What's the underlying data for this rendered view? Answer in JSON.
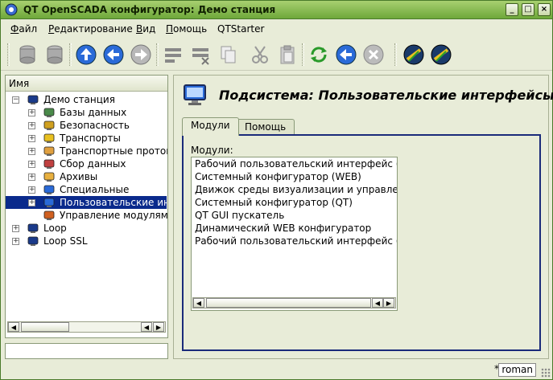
{
  "window": {
    "title": "QT OpenSCADA конфигуратор: Демо станция",
    "controls": [
      "_",
      "□",
      "×"
    ]
  },
  "menu": [
    {
      "label": "Файл",
      "underline": "Ф",
      "rest": "айл"
    },
    {
      "label": "Редактирование",
      "underline": "Р",
      "rest": "едактирование"
    },
    {
      "label": "Вид",
      "underline": "В",
      "rest": "ид"
    },
    {
      "label": "Помощь",
      "underline": "П",
      "rest": "омощь"
    },
    {
      "label": "QTStarter",
      "underline": "",
      "rest": "QTStarter"
    }
  ],
  "toolbar": {
    "icons": [
      "db-load-icon",
      "db-save-icon",
      "up-icon",
      "back-icon",
      "forward-icon",
      "add-item-icon",
      "delete-item-icon",
      "copy-icon",
      "cut-icon",
      "paste-icon",
      "refresh-icon",
      "start-icon",
      "stop-icon",
      "webcfg-icon",
      "vision-icon"
    ]
  },
  "tree": {
    "header": "Имя",
    "items": [
      {
        "label": "Демо станция",
        "level": 0,
        "expanded": true,
        "icon": "station-icon"
      },
      {
        "label": "Базы данных",
        "level": 1,
        "icon": "database-icon"
      },
      {
        "label": "Безопасность",
        "level": 1,
        "icon": "security-icon"
      },
      {
        "label": "Транспорты",
        "level": 1,
        "icon": "transport-icon"
      },
      {
        "label": "Транспортные протоко",
        "level": 1,
        "icon": "protocol-icon"
      },
      {
        "label": "Сбор данных",
        "level": 1,
        "icon": "daq-icon"
      },
      {
        "label": "Архивы",
        "level": 1,
        "icon": "archive-icon"
      },
      {
        "label": "Специальные",
        "level": 1,
        "icon": "special-icon"
      },
      {
        "label": "Пользовательские инт",
        "level": 1,
        "icon": "ui-icon",
        "selected": true
      },
      {
        "label": "Управление модулями",
        "level": 1,
        "icon": "modules-icon",
        "noexp": true
      },
      {
        "label": "Loop",
        "level": 0,
        "icon": "station-icon"
      },
      {
        "label": "Loop SSL",
        "level": 0,
        "icon": "station-icon"
      }
    ]
  },
  "main": {
    "title": "Подсистема: Пользовательские интерфейсы",
    "tabs": [
      "Модули",
      "Помощь"
    ],
    "active_tab": "Модули",
    "modules_label": "Модули:",
    "modules": [
      "Рабочий пользовательский интерфейс (QT)",
      "Системный конфигуратор (WEB)",
      "Движок среды визуализации и управления",
      "Системный конфигуратор (QT)",
      "QT GUI пускатель",
      "Динамический WEB конфигуратор",
      "Рабочий пользовательский интерфейс (WE"
    ]
  },
  "status": {
    "star": "*",
    "user": "roman"
  }
}
